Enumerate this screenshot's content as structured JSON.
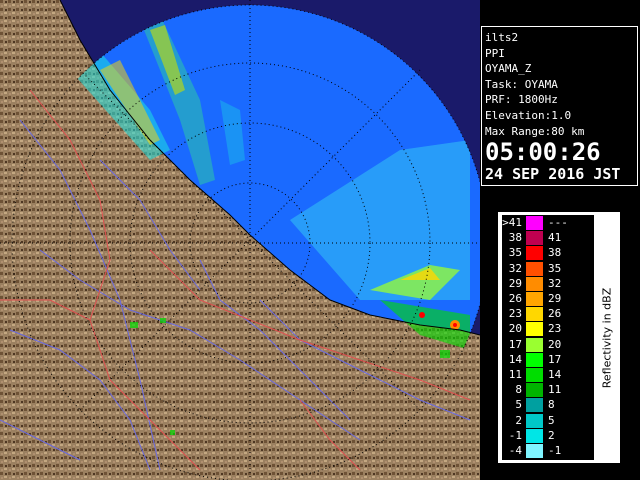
{
  "window": {
    "title": ""
  },
  "info_panel": {
    "lines": [
      "ilts2",
      "PPI",
      "OYAMA_Z",
      "Task: OYAMA",
      "PRF: 1800Hz",
      "Elevation:1.0",
      "Max Range:80 km"
    ],
    "time": "05:00:26",
    "date": "24 SEP 2016 JST"
  },
  "legend": {
    "unit_label": "Reflectivity in dBZ",
    "rows": [
      {
        "lo": ">41",
        "hi": "---",
        "color": "#ff00ff"
      },
      {
        "lo": "38",
        "hi": "41",
        "color": "#c00050"
      },
      {
        "lo": "35",
        "hi": "38",
        "color": "#ff0000"
      },
      {
        "lo": "32",
        "hi": "35",
        "color": "#ff5000"
      },
      {
        "lo": "29",
        "hi": "32",
        "color": "#ff8c00"
      },
      {
        "lo": "26",
        "hi": "29",
        "color": "#ffa500"
      },
      {
        "lo": "23",
        "hi": "26",
        "color": "#ffd700"
      },
      {
        "lo": "20",
        "hi": "23",
        "color": "#ffff00"
      },
      {
        "lo": "17",
        "hi": "20",
        "color": "#9aff30"
      },
      {
        "lo": "14",
        "hi": "17",
        "color": "#00ff00"
      },
      {
        "lo": "11",
        "hi": "14",
        "color": "#00dd00"
      },
      {
        "lo": "8",
        "hi": "11",
        "color": "#00b400"
      },
      {
        "lo": "5",
        "hi": "8",
        "color": "#00a0a0"
      },
      {
        "lo": "2",
        "hi": "5",
        "color": "#00c8c8"
      },
      {
        "lo": "-1",
        "hi": "2",
        "color": "#00e6e6"
      },
      {
        "lo": "-4",
        "hi": "-1",
        "color": "#7ff5ff"
      }
    ]
  },
  "colors": {
    "sea": "#1a6aff",
    "outside": "#1a1a6a",
    "land": "#9b8060",
    "land_dark": "#5a4030",
    "rivers": "#6a6ae0",
    "borders": "#e05050"
  },
  "icons": {
    "radar_map": "radar-ppi-map"
  }
}
